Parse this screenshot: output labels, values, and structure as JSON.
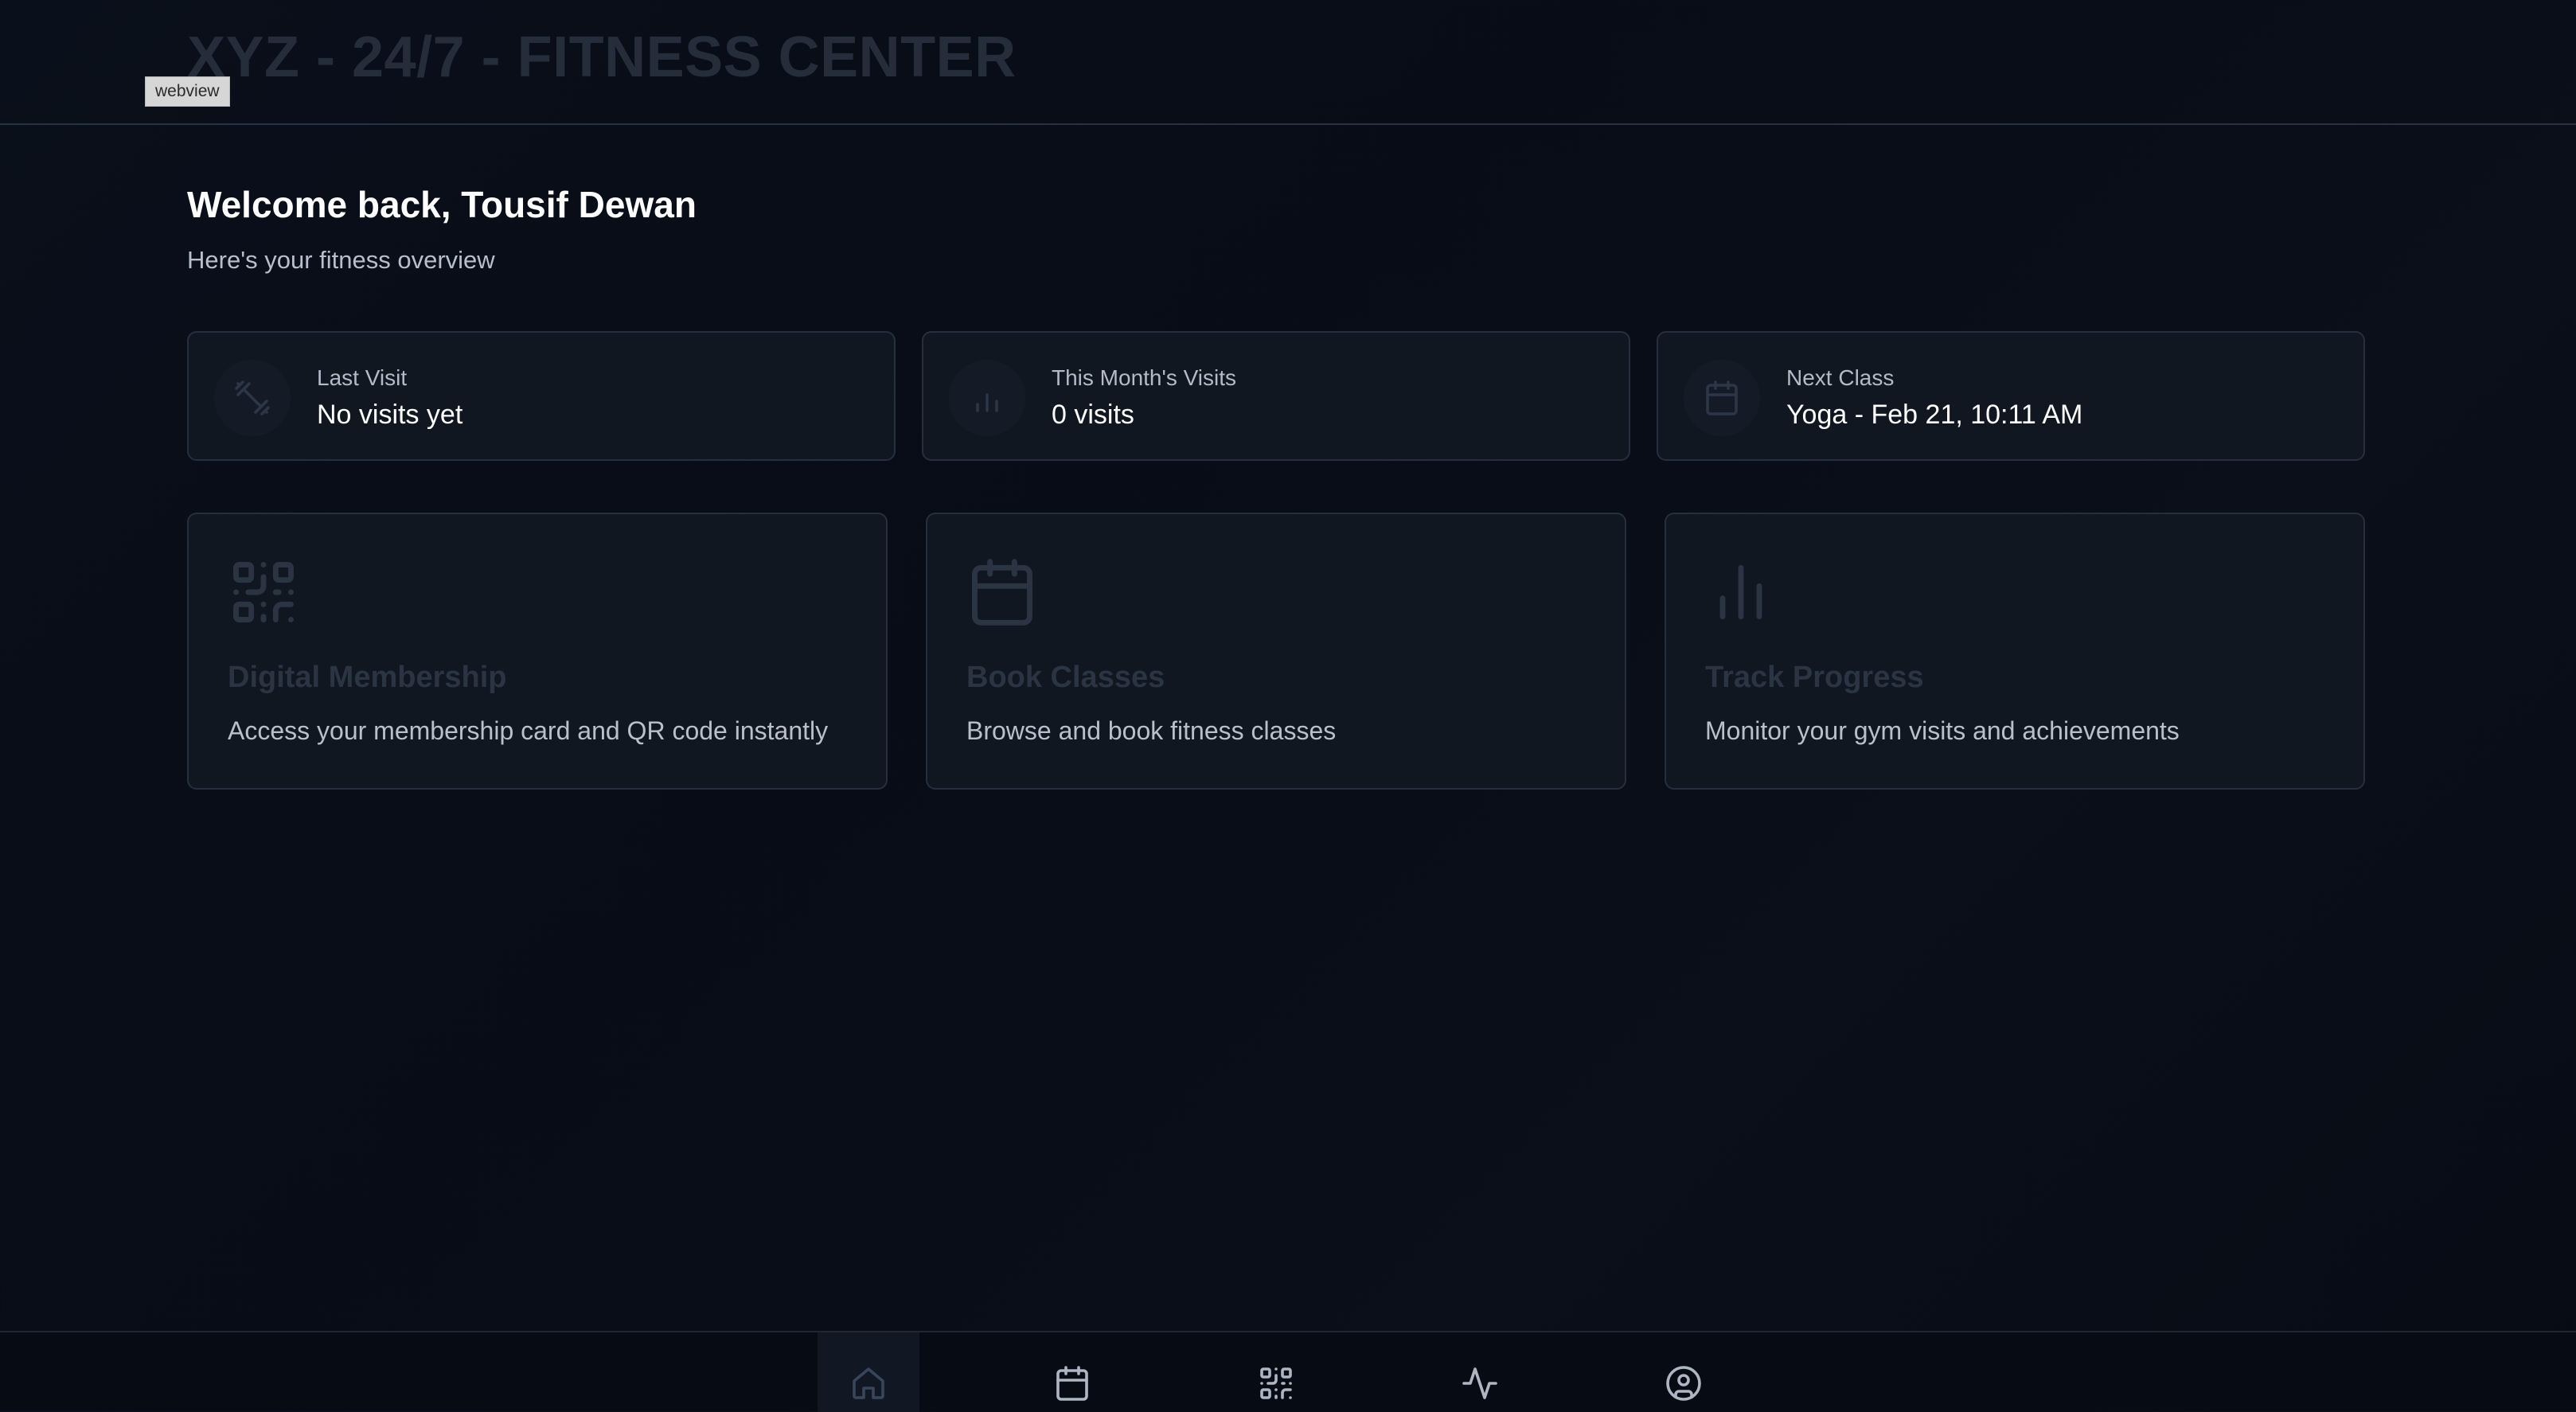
{
  "app": {
    "title": "XYZ - 24/7 - FITNESS CENTER",
    "webview_badge": "webview"
  },
  "welcome": {
    "title": "Welcome back, Tousif Dewan",
    "subtitle": "Here's your fitness overview"
  },
  "stats": [
    {
      "icon": "dumbbell-icon",
      "label": "Last Visit",
      "value": "No visits yet"
    },
    {
      "icon": "bar-chart-icon",
      "label": "This Month's Visits",
      "value": "0 visits"
    },
    {
      "icon": "calendar-icon",
      "label": "Next Class",
      "value": "Yoga - Feb 21, 10:11 AM"
    }
  ],
  "features": [
    {
      "icon": "qr-code-icon",
      "title": "Digital Membership",
      "description": "Access your membership card and QR code instantly"
    },
    {
      "icon": "calendar-icon",
      "title": "Book Classes",
      "description": "Browse and book fitness classes"
    },
    {
      "icon": "bar-chart-icon",
      "title": "Track Progress",
      "description": "Monitor your gym visits and achievements"
    }
  ],
  "bottom_nav": {
    "items": [
      {
        "icon": "home-icon",
        "active": true
      },
      {
        "icon": "calendar-icon",
        "active": false
      },
      {
        "icon": "qr-code-icon",
        "active": false
      },
      {
        "icon": "activity-icon",
        "active": false
      },
      {
        "icon": "user-circle-icon",
        "active": false
      }
    ]
  },
  "colors": {
    "background": "#070c16",
    "card_background": "#111721",
    "card_border": "#262f3e",
    "muted_title": "#2b3443",
    "text_primary": "#ffffff",
    "text_secondary": "#b8c0cc"
  }
}
